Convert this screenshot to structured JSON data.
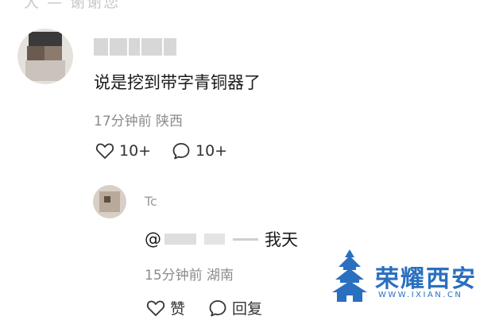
{
  "partial_header": "大 — 谢谢您",
  "main_comment": {
    "username_obscured": "",
    "text": "说是挖到带字青铜器了",
    "time": "17分钟前",
    "location": "陕西",
    "likes": "10+",
    "replies": "10+"
  },
  "reply": {
    "username_partial": "Tc",
    "mention_prefix": "@",
    "text": "我天",
    "time": "15分钟前",
    "location": "湖南",
    "like_label": "赞",
    "reply_label": "回复"
  },
  "watermark": {
    "name": "荣耀西安",
    "url": "WWW.IXIAN.CN",
    "color": "#2a6fc0"
  }
}
